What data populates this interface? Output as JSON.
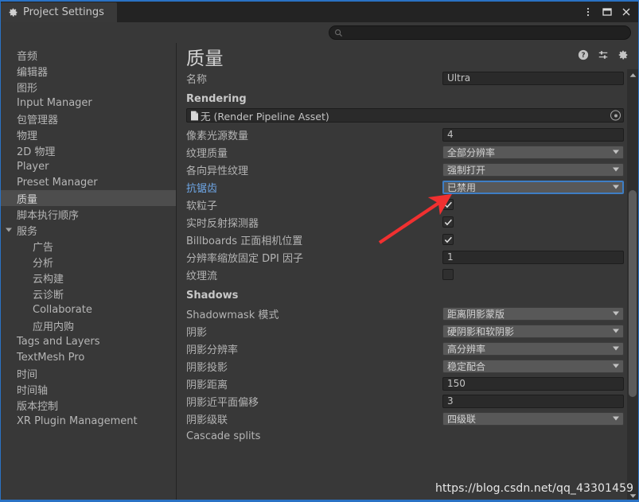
{
  "window": {
    "tab_label": "Project Settings",
    "tab_icon": "gear-icon",
    "controls": [
      {
        "name": "more-options-button",
        "glyph": "⋮"
      },
      {
        "name": "maximize-button",
        "glyph": "▢"
      },
      {
        "name": "close-button",
        "glyph": "✕"
      }
    ]
  },
  "search": {
    "value": "",
    "placeholder": "",
    "icon": "search-icon"
  },
  "sidebar": {
    "items": [
      {
        "label": "音频",
        "indent": false,
        "selected": false,
        "arrow": null
      },
      {
        "label": "编辑器",
        "indent": false,
        "selected": false,
        "arrow": null
      },
      {
        "label": "图形",
        "indent": false,
        "selected": false,
        "arrow": null
      },
      {
        "label": "Input Manager",
        "indent": false,
        "selected": false,
        "arrow": null
      },
      {
        "label": "包管理器",
        "indent": false,
        "selected": false,
        "arrow": null
      },
      {
        "label": "物理",
        "indent": false,
        "selected": false,
        "arrow": null
      },
      {
        "label": "2D 物理",
        "indent": false,
        "selected": false,
        "arrow": null
      },
      {
        "label": "Player",
        "indent": false,
        "selected": false,
        "arrow": null
      },
      {
        "label": "Preset Manager",
        "indent": false,
        "selected": false,
        "arrow": null
      },
      {
        "label": "质量",
        "indent": false,
        "selected": true,
        "arrow": null
      },
      {
        "label": "脚本执行顺序",
        "indent": false,
        "selected": false,
        "arrow": null
      },
      {
        "label": "服务",
        "indent": false,
        "selected": false,
        "arrow": "open"
      },
      {
        "label": "广告",
        "indent": true,
        "selected": false,
        "arrow": null
      },
      {
        "label": "分析",
        "indent": true,
        "selected": false,
        "arrow": null
      },
      {
        "label": "云构建",
        "indent": true,
        "selected": false,
        "arrow": null
      },
      {
        "label": "云诊断",
        "indent": true,
        "selected": false,
        "arrow": null
      },
      {
        "label": "Collaborate",
        "indent": true,
        "selected": false,
        "arrow": null
      },
      {
        "label": "应用内购",
        "indent": true,
        "selected": false,
        "arrow": null
      },
      {
        "label": "Tags and Layers",
        "indent": false,
        "selected": false,
        "arrow": null
      },
      {
        "label": "TextMesh Pro",
        "indent": false,
        "selected": false,
        "arrow": null
      },
      {
        "label": "时间",
        "indent": false,
        "selected": false,
        "arrow": null
      },
      {
        "label": "时间轴",
        "indent": false,
        "selected": false,
        "arrow": null
      },
      {
        "label": "版本控制",
        "indent": false,
        "selected": false,
        "arrow": null
      },
      {
        "label": "XR Plugin Management",
        "indent": false,
        "selected": false,
        "arrow": null
      }
    ]
  },
  "main": {
    "title": "质量",
    "header_icons": [
      {
        "name": "help-icon",
        "glyph": "?"
      },
      {
        "name": "preset-icon",
        "glyph": "preset"
      },
      {
        "name": "settings-gear-icon",
        "glyph": "gear"
      }
    ],
    "name_row": {
      "label": "名称",
      "value": "Ultra"
    },
    "sections": [
      {
        "title": "Rendering",
        "object_field": {
          "label": "无 (Render Pipeline Asset)",
          "icon": "file-icon",
          "picker": "object-picker-icon"
        },
        "rows": [
          {
            "label": "像素光源数量",
            "type": "text",
            "value": "4",
            "highlight": false
          },
          {
            "label": "纹理质量",
            "type": "dropdown",
            "value": "全部分辨率",
            "highlight": false,
            "focused": false
          },
          {
            "label": "各向异性纹理",
            "type": "dropdown",
            "value": "强制打开",
            "highlight": false,
            "focused": false
          },
          {
            "label": "抗锯齿",
            "type": "dropdown",
            "value": "已禁用",
            "highlight": true,
            "focused": true
          },
          {
            "label": "软粒子",
            "type": "checkbox",
            "value": true,
            "highlight": false
          },
          {
            "label": "实时反射探测器",
            "type": "checkbox",
            "value": true,
            "highlight": false
          },
          {
            "label": "Billboards 正面相机位置",
            "type": "checkbox",
            "value": true,
            "highlight": false
          },
          {
            "label": "分辨率缩放固定 DPI 因子",
            "type": "text",
            "value": "1",
            "highlight": false
          },
          {
            "label": "纹理流",
            "type": "checkbox",
            "value": false,
            "highlight": false
          }
        ]
      },
      {
        "title": "Shadows",
        "object_field": null,
        "rows": [
          {
            "label": "Shadowmask 模式",
            "type": "dropdown",
            "value": "距离阴影蒙版",
            "highlight": false,
            "focused": false
          },
          {
            "label": "阴影",
            "type": "dropdown",
            "value": "硬阴影和软阴影",
            "highlight": false,
            "focused": false
          },
          {
            "label": "阴影分辨率",
            "type": "dropdown",
            "value": "高分辨率",
            "highlight": false,
            "focused": false
          },
          {
            "label": "阴影投影",
            "type": "dropdown",
            "value": "稳定配合",
            "highlight": false,
            "focused": false
          },
          {
            "label": "阴影距离",
            "type": "text",
            "value": "150",
            "highlight": false
          },
          {
            "label": "阴影近平面偏移",
            "type": "text",
            "value": "3",
            "highlight": false
          },
          {
            "label": "阴影级联",
            "type": "dropdown",
            "value": "四级联",
            "highlight": false,
            "focused": false
          },
          {
            "label": "Cascade splits",
            "type": "none",
            "value": "",
            "highlight": false
          }
        ]
      }
    ],
    "scrollbar": {
      "name": "vertical-scrollbar"
    }
  },
  "annotation": {
    "arrow_color": "#f03030",
    "name": "red-arrow-annotation"
  },
  "watermark": {
    "text": "https://blog.csdn.net/qq_43301459"
  }
}
